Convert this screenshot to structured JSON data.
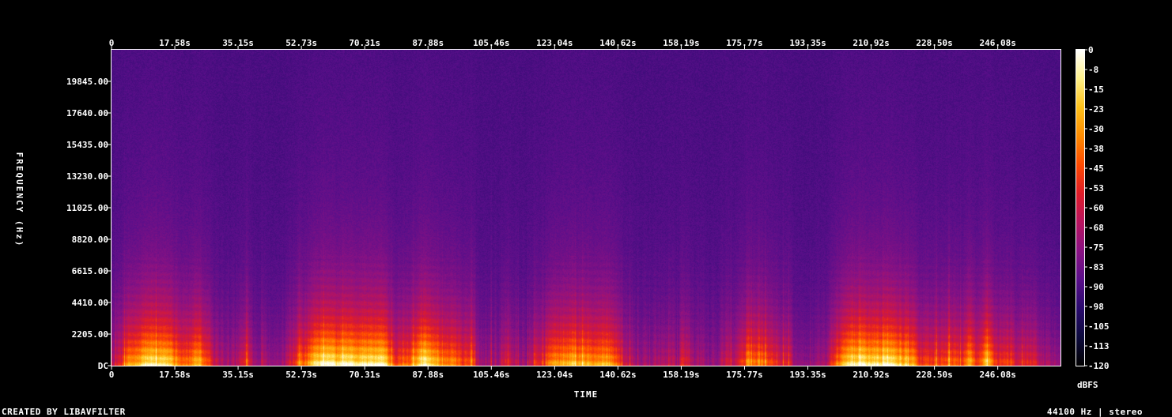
{
  "chart_data": {
    "type": "heatmap",
    "title": "",
    "xlabel": "TIME",
    "ylabel": "FREQUENCY (Hz)",
    "x_ticks": [
      "0",
      "17.58s",
      "35.15s",
      "52.73s",
      "70.31s",
      "87.88s",
      "105.46s",
      "123.04s",
      "140.62s",
      "158.19s",
      "175.77s",
      "193.35s",
      "210.92s",
      "228.50s",
      "246.08s"
    ],
    "x_tick_values": [
      0,
      17.58,
      35.15,
      52.73,
      70.31,
      87.88,
      105.46,
      123.04,
      140.62,
      158.19,
      175.77,
      193.35,
      210.92,
      228.5,
      246.08
    ],
    "xlim": [
      0,
      263.5
    ],
    "y_ticks": [
      "DC",
      "2205.00",
      "4410.00",
      "6615.00",
      "8820.00",
      "11025.00",
      "13230.00",
      "15435.00",
      "17640.00",
      "19845.00"
    ],
    "y_tick_values": [
      0,
      2205,
      4410,
      6615,
      8820,
      11025,
      13230,
      15435,
      17640,
      19845
    ],
    "ylim": [
      0,
      22050
    ],
    "colorbar": {
      "label": "dBFS",
      "ticks": [
        "0",
        "-8",
        "-15",
        "-23",
        "-30",
        "-38",
        "-45",
        "-53",
        "-60",
        "-68",
        "-75",
        "-83",
        "-90",
        "-98",
        "-105",
        "-113",
        "-120"
      ],
      "range": [
        -120,
        0
      ],
      "colors": [
        "#000000",
        "#0d0b3e",
        "#2a0b6e",
        "#5a0f8a",
        "#8a1283",
        "#b8145f",
        "#e01d28",
        "#ff4a00",
        "#ff8c00",
        "#ffc21a",
        "#fff18a",
        "#ffffff"
      ]
    }
  },
  "footer": {
    "left": "CREATED BY LIBAVFILTER",
    "right": "44100 Hz | stereo"
  }
}
